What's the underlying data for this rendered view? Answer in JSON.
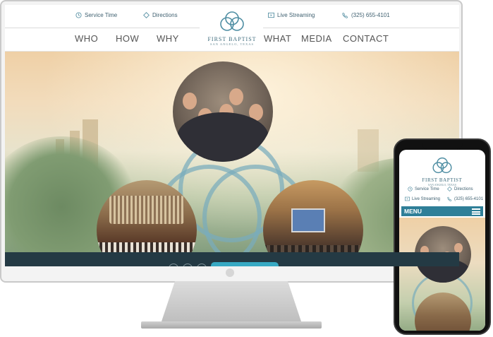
{
  "desktop": {
    "utility": {
      "service_time": "Service Time",
      "directions": "Directions",
      "live_streaming": "Live Streaming",
      "phone": "(325) 655-4101"
    },
    "nav": {
      "who": "WHO",
      "how": "HOW",
      "why": "WHY",
      "what": "WHAT",
      "media": "MEDIA",
      "contact": "CONTACT"
    },
    "logo": {
      "name": "FIRST BAPTIST",
      "sub": "SAN ANGELO, TEXAS"
    }
  },
  "mobile": {
    "logo": {
      "name": "FIRST BAPTIST",
      "sub": "SAN ANGELO, TEXAS"
    },
    "utility": {
      "service_time": "Service Time",
      "directions": "Directions",
      "live_streaming": "Live Streaming",
      "phone": "(325) 655-4101"
    },
    "menu_label": "MENU"
  },
  "colors": {
    "brand_teal": "#3d6b7c",
    "menu_bar": "#2f7f98",
    "footer_bar": "#243a44",
    "ring": "#78acbc"
  },
  "icons": {
    "service_time": "clock-icon",
    "directions": "diamond-arrow-icon",
    "live_streaming": "play-screen-icon",
    "phone": "phone-icon",
    "logo": "triquetra-icon",
    "menu": "hamburger-icon"
  }
}
